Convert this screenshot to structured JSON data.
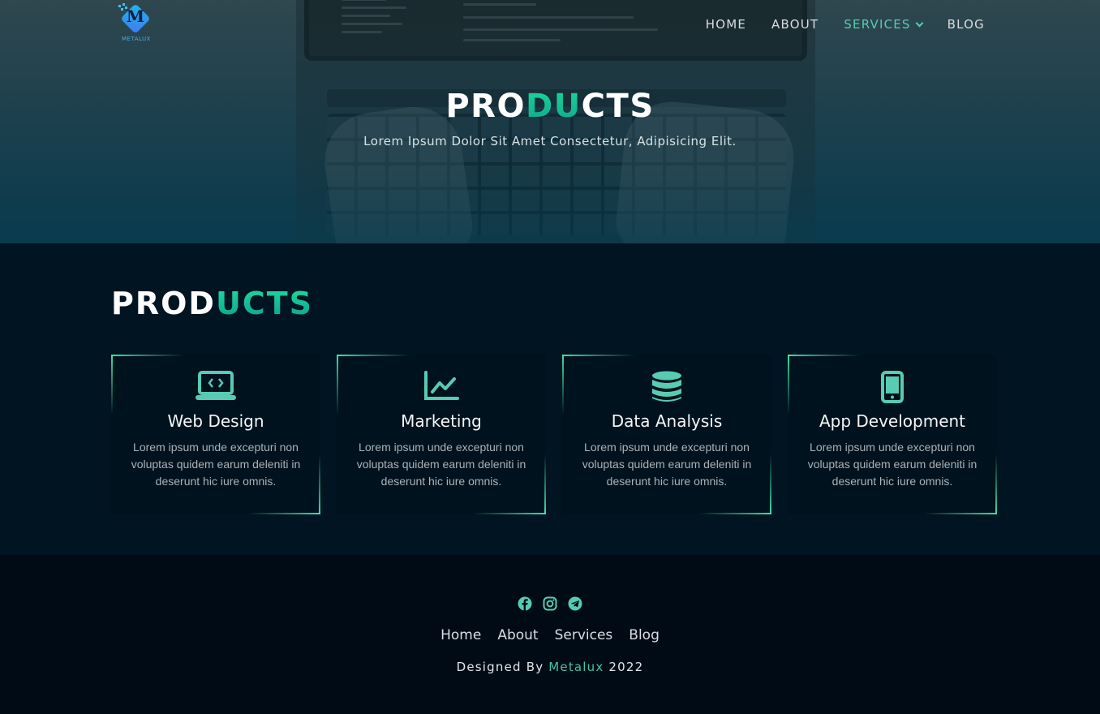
{
  "logo": {
    "text": "METALUX",
    "letter": "M",
    "icon": "metalux-logo-icon"
  },
  "nav": {
    "items": [
      {
        "label": "HOME"
      },
      {
        "label": "ABOUT"
      },
      {
        "label": "SERVICES",
        "active": true,
        "icon": "chevron-down-icon"
      },
      {
        "label": "BLOG"
      }
    ]
  },
  "hero": {
    "title_part1": "PRO",
    "title_highlight": "DU",
    "title_part2": "CTS",
    "subtitle": "Lorem Ipsum Dolor Sit Amet Consectetur, Adipisicing Elit."
  },
  "products": {
    "title_part1": "PROD",
    "title_highlight": "UCTS",
    "cards": [
      {
        "icon": "laptop-code-icon",
        "title": "Web Design",
        "text": "Lorem ipsum unde excepturi non voluptas quidem earum deleniti in deserunt hic iure omnis."
      },
      {
        "icon": "chart-line-icon",
        "title": "Marketing",
        "text": "Lorem ipsum unde excepturi non voluptas quidem earum deleniti in deserunt hic iure omnis."
      },
      {
        "icon": "database-icon",
        "title": "Data Analysis",
        "text": "Lorem ipsum unde excepturi non voluptas quidem earum deleniti in deserunt hic iure omnis."
      },
      {
        "icon": "mobile-icon",
        "title": "App Development",
        "text": "Lorem ipsum unde excepturi non voluptas quidem earum deleniti in deserunt hic iure omnis."
      }
    ]
  },
  "footer": {
    "socials": [
      "facebook-icon",
      "instagram-icon",
      "telegram-icon"
    ],
    "links": [
      {
        "label": "Home"
      },
      {
        "label": "About"
      },
      {
        "label": "Services"
      },
      {
        "label": "Blog"
      }
    ],
    "credit_prefix": "Designed By",
    "credit_brand": "Metalux",
    "credit_year": "2022"
  },
  "colors": {
    "accent": "#11c594",
    "accent_soft": "#57ccb2",
    "section_bg": "#001521",
    "footer_bg": "#000b16"
  }
}
